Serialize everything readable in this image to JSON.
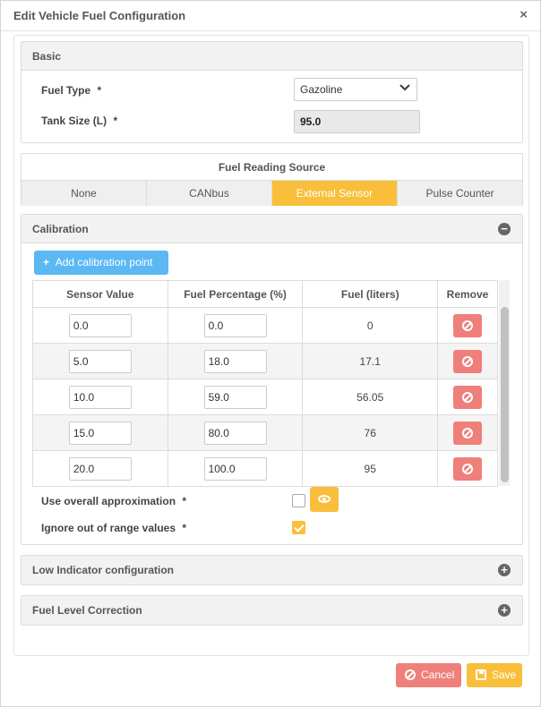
{
  "dialog": {
    "title": "Edit Vehicle Fuel Configuration",
    "close_glyph": "×"
  },
  "basic": {
    "title": "Basic",
    "fuel_type_label": "Fuel Type",
    "fuel_type_value": "Gazoline",
    "tank_size_label": "Tank Size (L)",
    "tank_size_value": "95.0",
    "required_mark": "*"
  },
  "source": {
    "title": "Fuel Reading Source",
    "tabs": [
      "None",
      "CANbus",
      "External Sensor",
      "Pulse Counter"
    ],
    "active_tab": "External Sensor"
  },
  "calibration": {
    "title": "Calibration",
    "add_label": "Add calibration point",
    "columns": [
      "Sensor Value",
      "Fuel Percentage (%)",
      "Fuel (liters)",
      "Remove"
    ],
    "rows": [
      {
        "sensor": "0.0",
        "percent": "0.0",
        "liters": "0"
      },
      {
        "sensor": "5.0",
        "percent": "18.0",
        "liters": "17.1"
      },
      {
        "sensor": "10.0",
        "percent": "59.0",
        "liters": "56.05"
      },
      {
        "sensor": "15.0",
        "percent": "80.0",
        "liters": "76"
      },
      {
        "sensor": "20.0",
        "percent": "100.0",
        "liters": "95"
      }
    ],
    "approx_label": "Use overall approximation",
    "approx_checked": false,
    "ignore_label": "Ignore out of range values",
    "ignore_checked": true
  },
  "low_indicator": {
    "title": "Low Indicator configuration"
  },
  "level_correction": {
    "title": "Fuel Level Correction"
  },
  "footer": {
    "cancel_label": "Cancel",
    "save_label": "Save"
  },
  "colors": {
    "accent": "#f9bf3b",
    "danger": "#ef7f7a",
    "info": "#5bb8f5"
  }
}
